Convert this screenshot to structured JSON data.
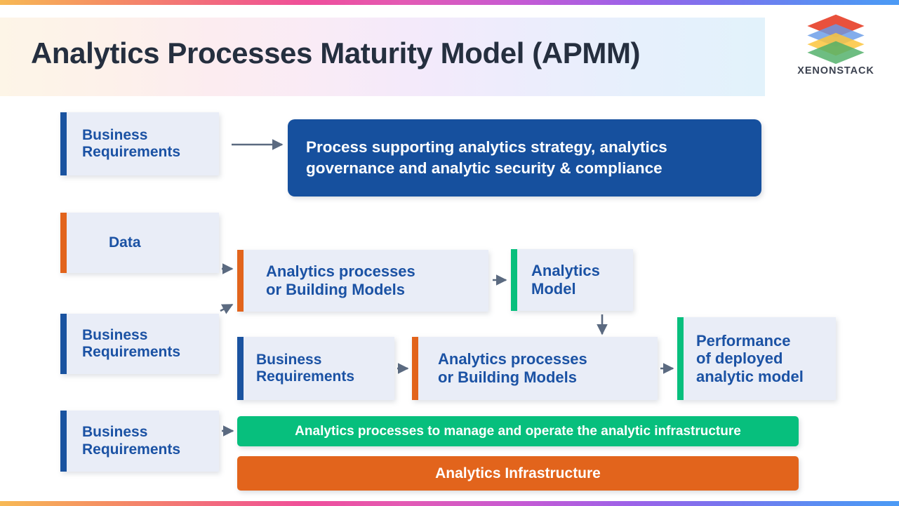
{
  "header": {
    "title": "Analytics Processes Maturity Model (APMM)",
    "logo": {
      "name": "xenonstack-logo",
      "wordmark": "XENONSTACK",
      "layer_colors": [
        "#e8432c",
        "#5b92e5",
        "#fbc02d",
        "#3fa85a"
      ]
    },
    "band_gradient_from": "#fdf5e7",
    "band_gradient_to": "#e2f2fb"
  },
  "accent_rule": {
    "gradient_stops": [
      "#f7b955",
      "#ef4f9a",
      "#9d62e8",
      "#4b9bf5"
    ]
  },
  "palette": {
    "card_bg": "#e9edf7",
    "card_text": "#1b52a4",
    "accent_blue": "#1a53a0",
    "accent_orange": "#e2641c",
    "accent_green": "#07bf7d",
    "banner_blue": "#16509e",
    "banner_green": "#07bf7d",
    "banner_orange": "#e2641c",
    "arrow": "#5b6a80",
    "title_text": "#252f3f"
  },
  "diagram": {
    "rows": [
      {
        "row_name": "strategy-governance-row",
        "input": {
          "label": "Business\nRequirements",
          "accent": "blue"
        },
        "output": {
          "label": "Process supporting analytics strategy, analytics governance and analytic security & compliance",
          "style": "banner-blue"
        }
      },
      {
        "row_name": "model-building-row",
        "inputs": [
          {
            "label": "Data",
            "accent": "orange"
          },
          {
            "label": "Business\nRequirements",
            "accent": "blue"
          }
        ],
        "process": {
          "label": "Analytics processes\nor Building Models",
          "accent": "orange"
        },
        "output": {
          "label": "Analytics\nModel",
          "accent": "green"
        }
      },
      {
        "row_name": "deployment-row",
        "input": {
          "label": "Business\nRequirements",
          "accent": "blue"
        },
        "process": {
          "label": "Analytics processes\nor Building Models",
          "accent": "orange"
        },
        "output": {
          "label": "Performance\nof deployed\nanalytic model",
          "accent": "green"
        }
      },
      {
        "row_name": "infrastructure-row",
        "input": {
          "label": "Business\nRequirements",
          "accent": "blue"
        },
        "outputs": [
          {
            "label": "Analytics processes to manage and operate the analytic infrastructure",
            "style": "banner-green"
          },
          {
            "label": "Analytics Infrastructure",
            "style": "banner-orange"
          }
        ]
      }
    ],
    "labels": {
      "business_requirements": "Business\nRequirements",
      "data": "Data",
      "analytics_processes": "Analytics processes\nor Building Models",
      "analytics_model": "Analytics\nModel",
      "performance": "Performance\nof deployed\nanalytic model",
      "process_supporting": "Process supporting analytics strategy, analytics governance and analytic security & compliance",
      "manage_operate": "Analytics processes to manage and operate the analytic infrastructure",
      "analytics_infrastructure": "Analytics Infrastructure"
    }
  }
}
